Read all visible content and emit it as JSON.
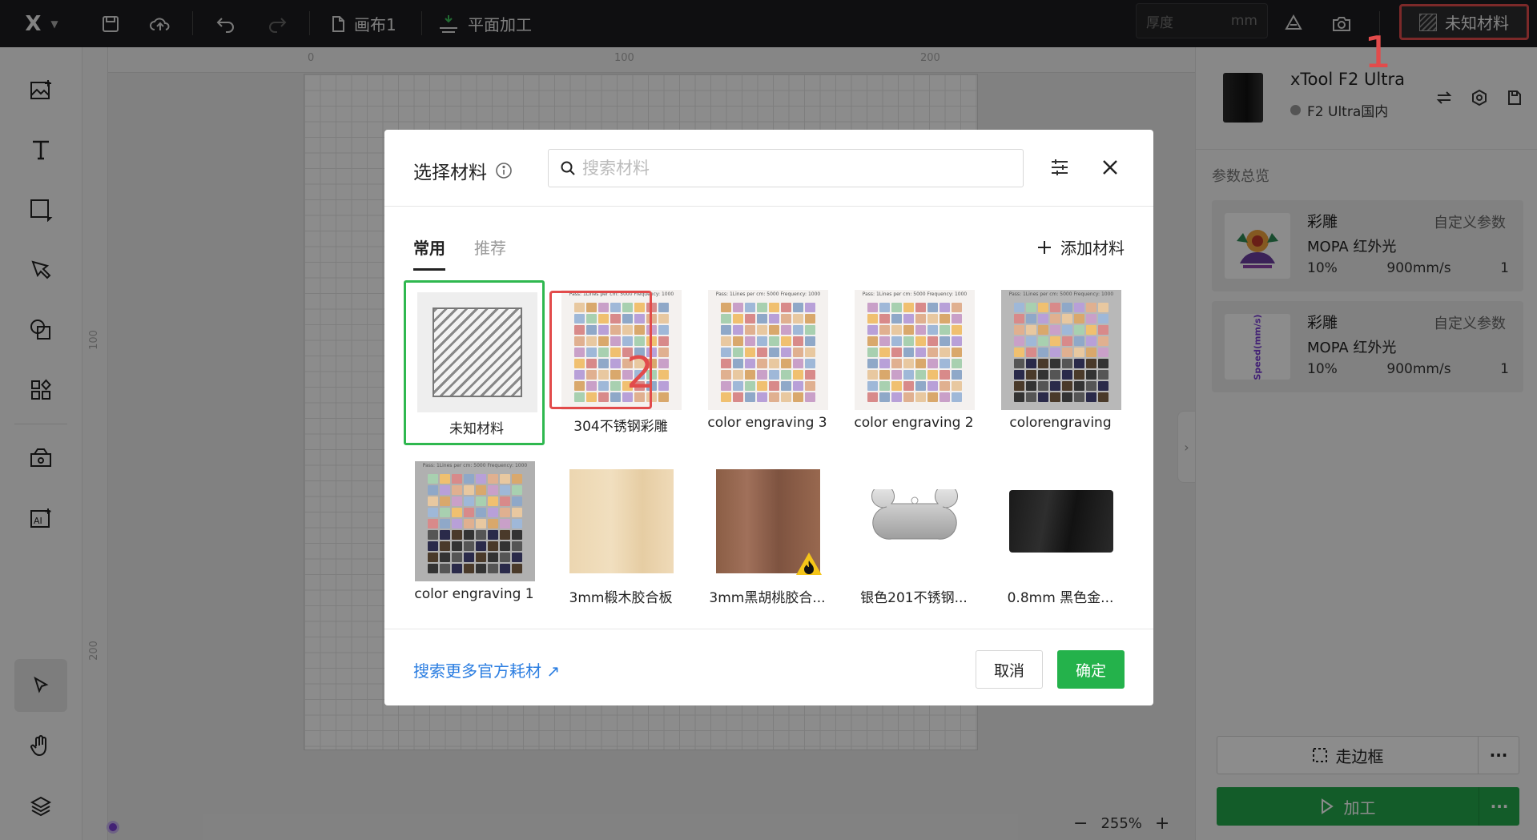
{
  "topbar": {
    "logo": "X",
    "canvas_name": "画布1",
    "mode": "平面加工",
    "thickness_placeholder": "厚度",
    "thickness_unit": "mm",
    "material_label": "未知材料"
  },
  "annotations": {
    "one": "1",
    "two": "2"
  },
  "ruler": {
    "top": [
      "0",
      "100",
      "200"
    ],
    "left": [
      "100",
      "200"
    ]
  },
  "canvas": {
    "zoom": "255%"
  },
  "device": {
    "name": "xTool F2 Ultra",
    "status": "F2 Ultra国内"
  },
  "overview": {
    "title": "参数总览",
    "cards": [
      {
        "title": "彩雕",
        "tag": "自定义参数",
        "mode": "MOPA 红外光",
        "power": "10%",
        "speed": "900mm/s",
        "passes": "1"
      },
      {
        "title": "彩雕",
        "tag": "自定义参数",
        "mode": "MOPA 红外光",
        "power": "10%",
        "speed": "900mm/s",
        "passes": "1",
        "thumb_text": "Speed(mm/s)"
      }
    ]
  },
  "actions": {
    "frame": "走边框",
    "process": "加工",
    "more": "···"
  },
  "modal": {
    "title": "选择材料",
    "search_placeholder": "搜索材料",
    "tabs": [
      "常用",
      "推荐"
    ],
    "add_material": "添加材料",
    "materials": [
      "未知材料",
      "304不锈钢彩雕",
      "color engraving 3",
      "color engraving 2",
      "colorengraving",
      "color engraving 1",
      "3mm椴木胶合板",
      "3mm黑胡桃胶合...",
      "银色201不锈钢...",
      "0.8mm 黑色金..."
    ],
    "sheet_header": "Pass: 1Lines per cm: 5000 Frequency: 1000",
    "more_link": "搜索更多官方耗材",
    "cancel": "取消",
    "ok": "确定"
  }
}
